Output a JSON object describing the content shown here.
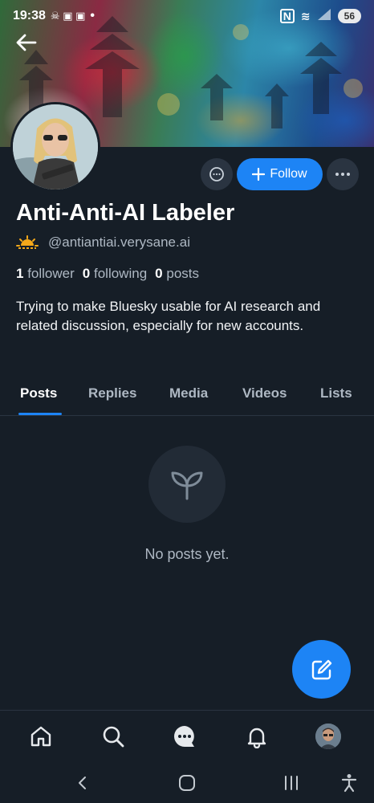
{
  "status_bar": {
    "time": "19:38",
    "dot": "•",
    "nfc_label": "N",
    "battery": "56"
  },
  "profile": {
    "display_name": "Anti-Anti-AI Labeler",
    "handle": "@antiantiai.verysane.ai",
    "followers_count": "1",
    "followers_label": "follower",
    "following_count": "0",
    "following_label": "following",
    "posts_count": "0",
    "posts_label": "posts",
    "bio": "Trying to make Bluesky usable for AI research and related discussion, especially for new accounts."
  },
  "actions": {
    "follow_label": "Follow",
    "follow_icon": "plus-icon",
    "message_icon": "chat-bubble-icon",
    "more_icon": "ellipsis-icon"
  },
  "tabs": [
    {
      "label": "Posts",
      "active": true
    },
    {
      "label": "Replies",
      "active": false
    },
    {
      "label": "Media",
      "active": false
    },
    {
      "label": "Videos",
      "active": false
    },
    {
      "label": "Lists",
      "active": false
    }
  ],
  "empty_state": {
    "icon": "sprout-icon",
    "message": "No posts yet."
  },
  "bottom_nav": [
    "home-icon",
    "search-icon",
    "chat-icon",
    "bell-icon",
    "avatar"
  ],
  "colors": {
    "accent": "#1d84f5",
    "background": "#161e27",
    "muted_text": "#aeb8c3"
  }
}
